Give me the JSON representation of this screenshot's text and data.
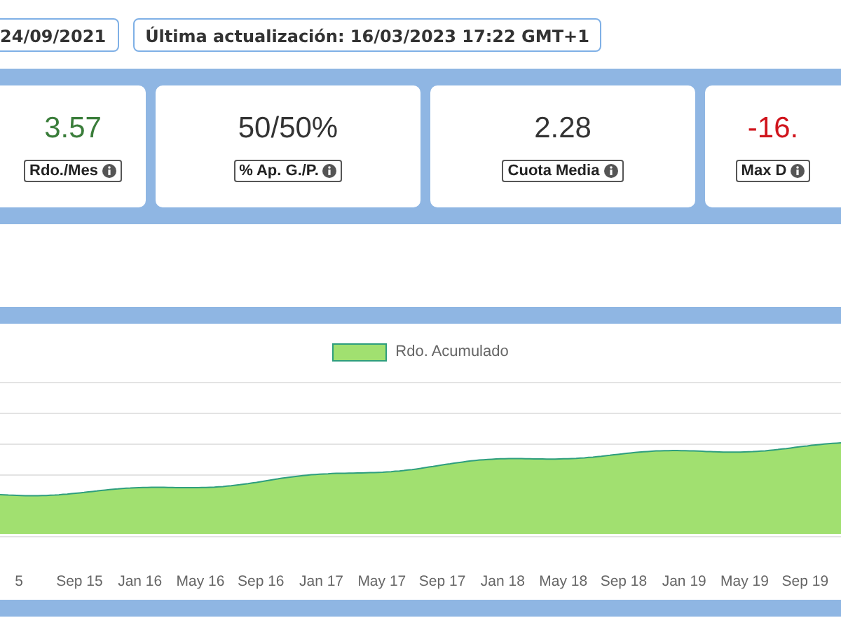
{
  "header": {
    "badges": [
      {
        "text": "24/09/2021"
      },
      {
        "text": "Última actualización: 16/03/2023 17:22 GMT+1"
      }
    ]
  },
  "stats": [
    {
      "value": "3.57",
      "label": "Rdo./Mes",
      "color": "#3a7d3a"
    },
    {
      "value": "50/50%",
      "label": "% Ap. G./P.",
      "color": "#333333"
    },
    {
      "value": "2.28",
      "label": "Cuota Media",
      "color": "#333333"
    },
    {
      "value": "-16.",
      "label": "Max D",
      "color": "#d0141c"
    }
  ],
  "chart": {
    "legend": "Rdo. Acumulado",
    "xlabels": [
      "5",
      "Sep 15",
      "Jan 16",
      "May 16",
      "Sep 16",
      "Jan 17",
      "May 17",
      "Sep 17",
      "Jan 18",
      "May 18",
      "Sep 18",
      "Jan 19",
      "May 19",
      "Sep 19"
    ]
  }
}
